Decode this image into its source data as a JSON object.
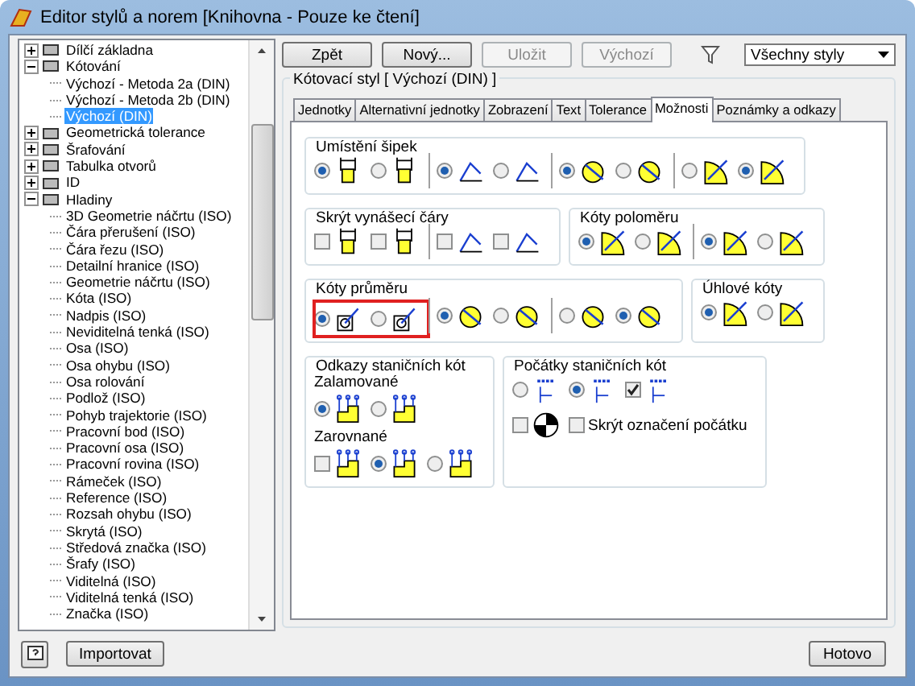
{
  "window": {
    "title": "Editor stylů a norem [Knihovna - Pouze ke čtení]"
  },
  "tree": [
    {
      "label": "Dílčí základna",
      "expanded": false,
      "selected": false
    },
    {
      "label": "Kótování",
      "expanded": true,
      "selected": false,
      "children": [
        {
          "label": "Výchozí - Metoda 2a (DIN)",
          "selected": false
        },
        {
          "label": "Výchozí - Metoda 2b (DIN)",
          "selected": false
        },
        {
          "label": "Výchozí (DIN)",
          "selected": true
        }
      ]
    },
    {
      "label": "Geometrická tolerance",
      "expanded": false,
      "selected": false
    },
    {
      "label": "Šrafování",
      "expanded": false,
      "selected": false
    },
    {
      "label": "Tabulka otvorů",
      "expanded": false,
      "selected": false
    },
    {
      "label": "ID",
      "expanded": false,
      "selected": false
    },
    {
      "label": "Hladiny",
      "expanded": true,
      "selected": false,
      "children": [
        {
          "label": "3D Geometrie náčrtu (ISO)",
          "selected": false
        },
        {
          "label": "Čára přerušení (ISO)",
          "selected": false
        },
        {
          "label": "Čára řezu (ISO)",
          "selected": false
        },
        {
          "label": "Detailní hranice (ISO)",
          "selected": false
        },
        {
          "label": "Geometrie náčrtu (ISO)",
          "selected": false
        },
        {
          "label": "Kóta (ISO)",
          "selected": false
        },
        {
          "label": "Nadpis (ISO)",
          "selected": false
        },
        {
          "label": "Neviditelná tenká (ISO)",
          "selected": false
        },
        {
          "label": "Osa (ISO)",
          "selected": false
        },
        {
          "label": "Osa ohybu (ISO)",
          "selected": false
        },
        {
          "label": "Osa rolování",
          "selected": false
        },
        {
          "label": "Podlož (ISO)",
          "selected": false
        },
        {
          "label": "Pohyb trajektorie (ISO)",
          "selected": false
        },
        {
          "label": "Pracovní bod (ISO)",
          "selected": false
        },
        {
          "label": "Pracovní osa (ISO)",
          "selected": false
        },
        {
          "label": "Pracovní rovina (ISO)",
          "selected": false
        },
        {
          "label": "Rámeček (ISO)",
          "selected": false
        },
        {
          "label": "Reference (ISO)",
          "selected": false
        },
        {
          "label": "Rozsah ohybu (ISO)",
          "selected": false
        },
        {
          "label": "Skrytá (ISO)",
          "selected": false
        },
        {
          "label": "Středová značka (ISO)",
          "selected": false
        },
        {
          "label": "Šrafy (ISO)",
          "selected": false
        },
        {
          "label": "Viditelná (ISO)",
          "selected": false
        },
        {
          "label": "Viditelná tenká (ISO)",
          "selected": false
        },
        {
          "label": "Značka (ISO)",
          "selected": false
        }
      ]
    }
  ],
  "toolbar": {
    "buttons": [
      {
        "label": "Zpět",
        "disabled": false
      },
      {
        "label": "Nový...",
        "disabled": false
      },
      {
        "label": "Uložit",
        "disabled": true
      },
      {
        "label": "Výchozí",
        "disabled": true
      }
    ],
    "filter": {
      "value": "Všechny styly"
    }
  },
  "style_panel": {
    "title": "Kótovací styl [ Výchozí (DIN) ]",
    "tabs": [
      {
        "label": "Jednotky",
        "selected": false
      },
      {
        "label": "Alternativní jednotky",
        "selected": false
      },
      {
        "label": "Zobrazení",
        "selected": false
      },
      {
        "label": "Text",
        "selected": false
      },
      {
        "label": "Tolerance",
        "selected": false
      },
      {
        "label": "Možnosti",
        "selected": true
      },
      {
        "label": "Poznámky a odkazy",
        "selected": false
      }
    ],
    "group_rows": [
      [
        {
          "title": "Umístění šipek",
          "rows": [
            {
              "sets": [
                {
                  "highlighted": false,
                  "options": [
                    {
                      "kind": "radio",
                      "selected": true
                    },
                    {
                      "kind": "radio",
                      "selected": false
                    }
                  ]
                },
                {
                  "highlighted": false,
                  "options": [
                    {
                      "kind": "radio",
                      "selected": true
                    },
                    {
                      "kind": "radio",
                      "selected": false
                    }
                  ]
                },
                {
                  "highlighted": false,
                  "options": [
                    {
                      "kind": "radio",
                      "selected": true
                    },
                    {
                      "kind": "radio",
                      "selected": false
                    }
                  ]
                },
                {
                  "highlighted": false,
                  "options": [
                    {
                      "kind": "radio",
                      "selected": false
                    },
                    {
                      "kind": "radio",
                      "selected": true
                    }
                  ]
                }
              ]
            }
          ]
        }
      ],
      [
        {
          "title": "Skrýt vynášecí čáry",
          "rows": [
            {
              "sets": [
                {
                  "highlighted": false,
                  "options": [
                    {
                      "kind": "checkbox",
                      "checked": false
                    },
                    {
                      "kind": "checkbox",
                      "checked": false
                    }
                  ]
                },
                {
                  "highlighted": false,
                  "options": [
                    {
                      "kind": "checkbox",
                      "checked": false
                    },
                    {
                      "kind": "checkbox",
                      "checked": false
                    }
                  ]
                }
              ]
            }
          ]
        },
        {
          "title": "Kóty poloměru",
          "rows": [
            {
              "sets": [
                {
                  "highlighted": false,
                  "options": [
                    {
                      "kind": "radio",
                      "selected": true
                    },
                    {
                      "kind": "radio",
                      "selected": false
                    }
                  ]
                },
                {
                  "highlighted": false,
                  "options": [
                    {
                      "kind": "radio",
                      "selected": true
                    },
                    {
                      "kind": "radio",
                      "selected": false
                    }
                  ]
                }
              ]
            }
          ]
        }
      ],
      [
        {
          "title": "Kóty průměru",
          "rows": [
            {
              "sets": [
                {
                  "highlighted": true,
                  "options": [
                    {
                      "kind": "radio",
                      "selected": true
                    },
                    {
                      "kind": "radio",
                      "selected": false
                    }
                  ]
                },
                {
                  "highlighted": false,
                  "options": [
                    {
                      "kind": "radio",
                      "selected": true
                    },
                    {
                      "kind": "radio",
                      "selected": false
                    }
                  ]
                },
                {
                  "highlighted": false,
                  "options": [
                    {
                      "kind": "radio",
                      "selected": false
                    },
                    {
                      "kind": "radio",
                      "selected": true
                    }
                  ]
                }
              ]
            }
          ]
        },
        {
          "title": "Úhlové kóty",
          "rows": [
            {
              "sets": [
                {
                  "options": [
                    {
                      "kind": "radio",
                      "selected": true
                    },
                    {
                      "kind": "radio",
                      "selected": false
                    }
                  ]
                }
              ]
            }
          ]
        }
      ],
      [
        {
          "title": "Odkazy staničních kót",
          "rows": [
            {
              "label": "Zalamované",
              "sets": [
                {
                  "options": [
                    {
                      "kind": "radio",
                      "selected": true
                    },
                    {
                      "kind": "radio",
                      "selected": false
                    }
                  ]
                }
              ]
            },
            {
              "label": "Zarovnané",
              "sets": [
                {
                  "options": [
                    {
                      "kind": "checkbox",
                      "checked": false
                    },
                    {
                      "kind": "radio",
                      "selected": true
                    },
                    {
                      "kind": "radio",
                      "selected": false
                    }
                  ]
                }
              ]
            }
          ]
        },
        {
          "title": "Počátky staničních kót",
          "rows": [
            {
              "sets": [
                {
                  "options": [
                    {
                      "kind": "radio",
                      "selected": false
                    },
                    {
                      "kind": "radio",
                      "selected": true
                    },
                    {
                      "kind": "checkbox",
                      "checked": true
                    }
                  ]
                }
              ]
            },
            {
              "sets": [
                {
                  "options": [
                    {
                      "kind": "checkbox",
                      "checked": false
                    },
                    {
                      "kind": "checkbox",
                      "checked": false,
                      "label": "Skrýt označení počátku"
                    }
                  ]
                }
              ]
            }
          ]
        }
      ]
    ]
  },
  "footer": {
    "import_button": "Importovat",
    "done_button": "Hotovo"
  }
}
